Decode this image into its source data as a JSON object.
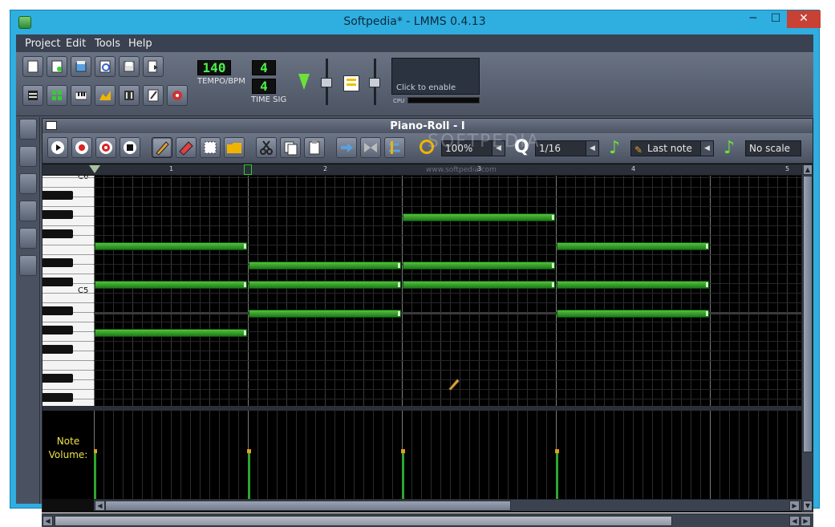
{
  "window": {
    "title": "Softpedia* - LMMS 0.4.13",
    "minimize": "─",
    "maximize": "☐",
    "close": "✕"
  },
  "menu": [
    "Project",
    "Edit",
    "Tools",
    "Help"
  ],
  "transport": {
    "tempo_value": "140",
    "tempo_label": "TEMPO/BPM",
    "timesig_num": "4",
    "timesig_den": "4",
    "timesig_label": "TIME SIG"
  },
  "graph": {
    "enable_text": "Click to enable",
    "cpu_label": "CPU"
  },
  "piano_roll": {
    "title": "Piano-Roll - I",
    "zoom": "100%",
    "q_label": "Q",
    "quantize": "1/16",
    "note_length": "Last note",
    "scale": "No scale",
    "timeline_ticks": [
      "1",
      "2",
      "3",
      "4",
      "5"
    ],
    "key_labels": [
      "C6",
      "C5"
    ],
    "volume_label_line1": "Note",
    "volume_label_line2": "Volume:",
    "watermark": "www.softpedia.com",
    "watermark_logo": "SOFTPEDIA"
  },
  "colors": {
    "accent": "#2faee0",
    "close": "#c74234",
    "note": "#2fa52f",
    "volume_label": "#f0e24a"
  },
  "icons": {
    "toolbar": [
      "new-project-icon",
      "new-from-template-icon",
      "open-project-icon",
      "recent-projects-icon",
      "save-icon",
      "export-icon",
      "song-editor-icon",
      "beat-bassline-icon",
      "piano-roll-icon",
      "automation-editor-icon",
      "fx-mixer-icon",
      "project-notes-icon",
      "controller-rack-icon"
    ],
    "sidebar": [
      "instrument-plugins-icon",
      "my-projects-icon",
      "my-samples-icon",
      "my-presets-icon",
      "my-home-icon",
      "root-directory-icon"
    ]
  }
}
